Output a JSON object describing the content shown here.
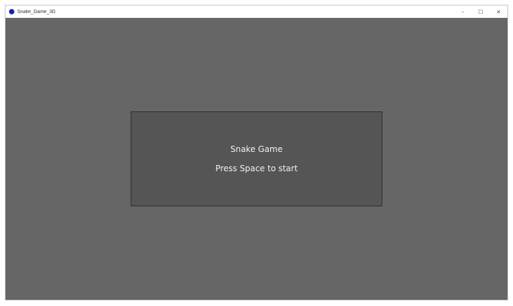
{
  "window": {
    "title": "Snake_Game_3D",
    "controls": {
      "minimize_glyph": "–",
      "maximize_glyph": "☐",
      "close_glyph": "✕"
    }
  },
  "game": {
    "menu": {
      "title": "Snake Game",
      "prompt": "Press Space to start"
    }
  },
  "colors": {
    "canvas_background": "#666666",
    "panel_background": "#555555",
    "panel_border": "#2e2e2e",
    "text": "#f2f2f2",
    "app_icon": "#1a1aa8"
  },
  "icons": {
    "app": "app-logo-icon",
    "minimize": "minimize-icon",
    "maximize": "maximize-icon",
    "close": "close-icon"
  }
}
